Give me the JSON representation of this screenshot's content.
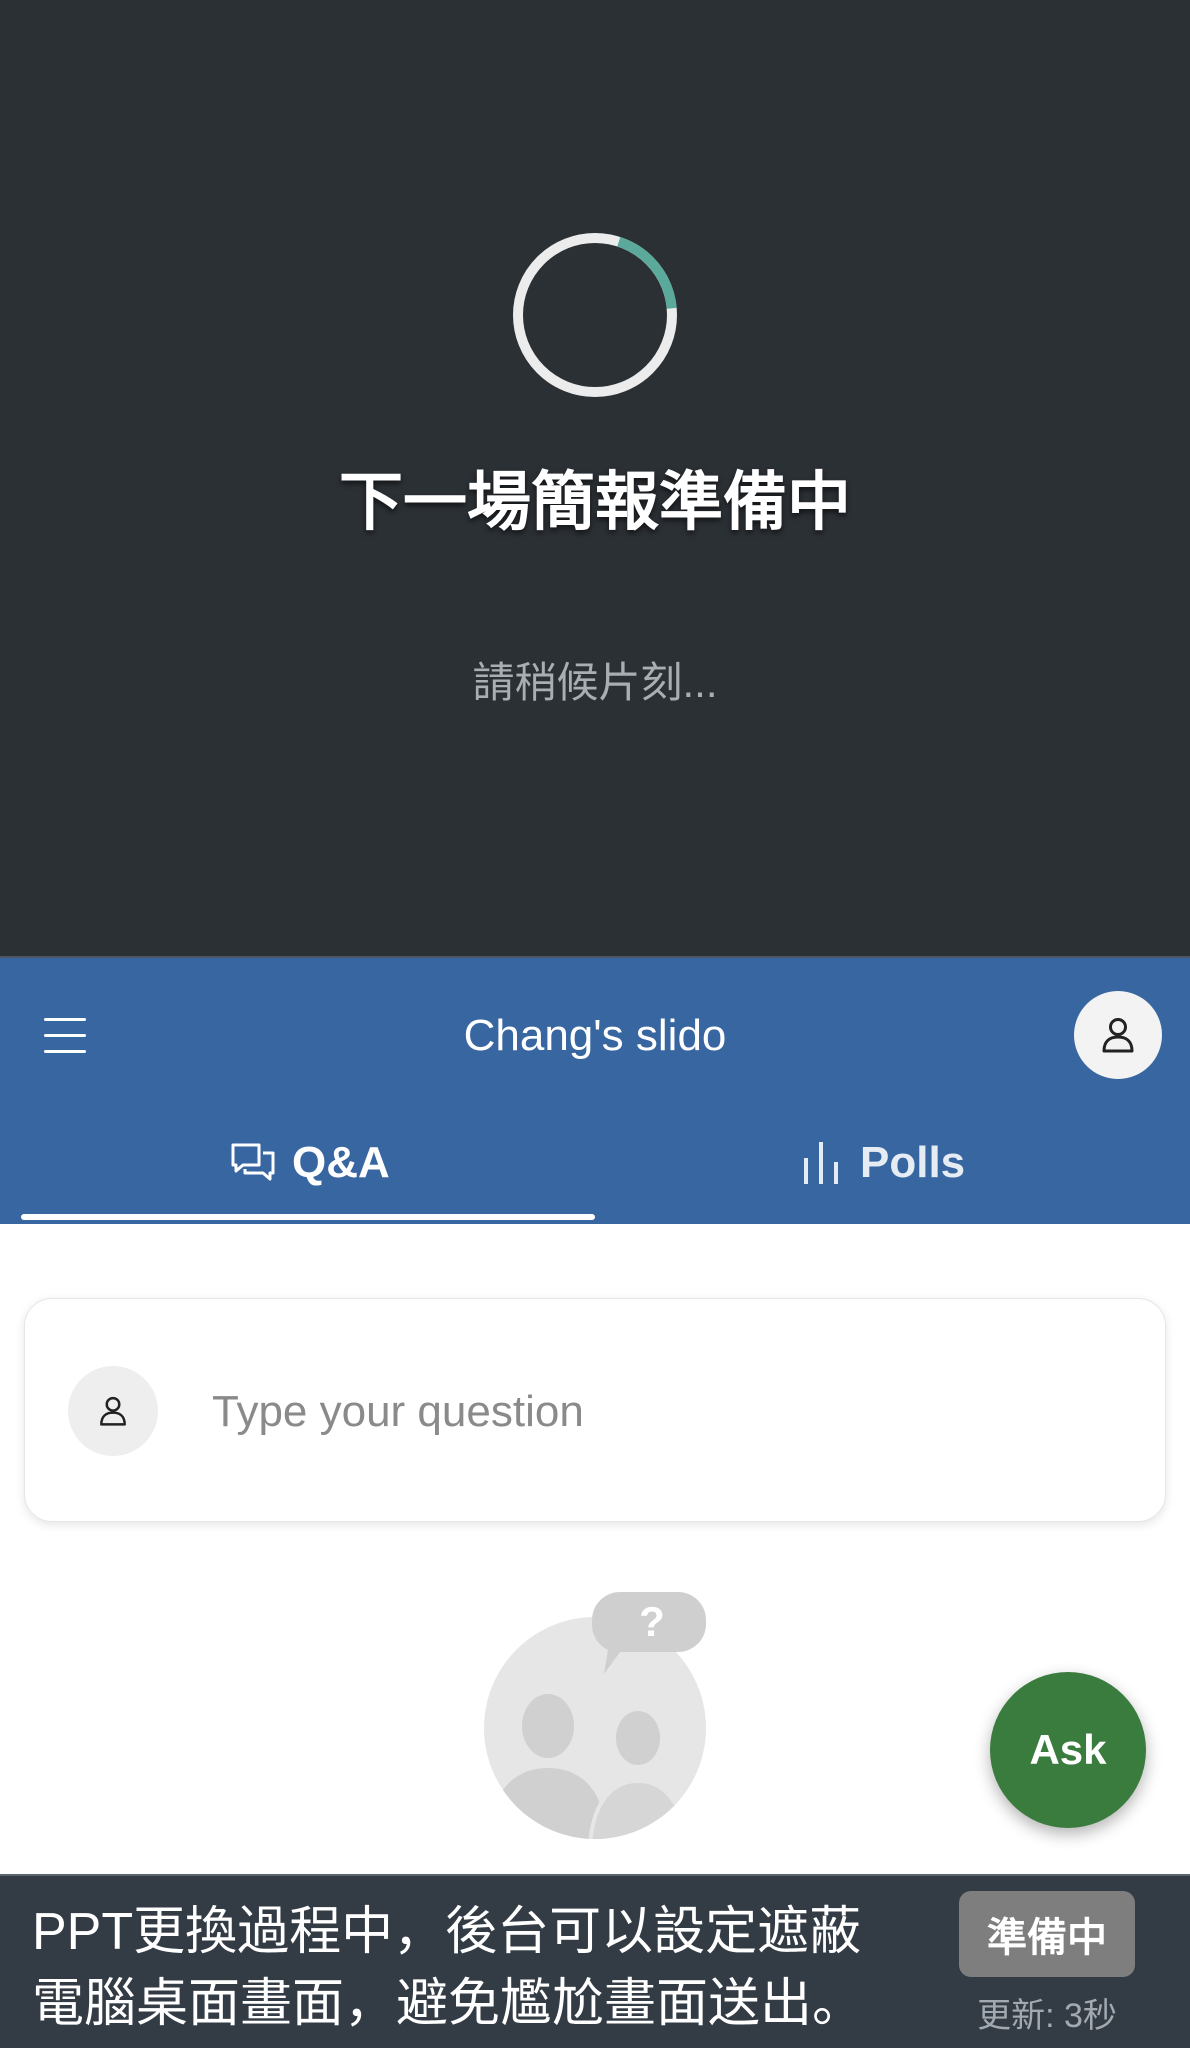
{
  "colors": {
    "top_background": "#2b3035",
    "header_background": "#3866a1",
    "spinner_accent": "#5aa99a",
    "spinner_track": "#ececec",
    "ask_button": "#3a7c3d",
    "bottom_bar": "#333b44",
    "status_badge": "#7e7e7e"
  },
  "loading": {
    "title": "下一場簡報準備中",
    "subtitle": "請稍候片刻..."
  },
  "header": {
    "menu_icon": "hamburger-menu-icon",
    "title": "Chang's slido",
    "avatar_icon": "user-icon"
  },
  "tabs": [
    {
      "label": "Q&A",
      "icon": "chat-bubbles-icon",
      "active": true
    },
    {
      "label": "Polls",
      "icon": "bar-chart-icon",
      "active": false
    }
  ],
  "question_box": {
    "avatar_icon": "user-icon",
    "placeholder": "Type your question"
  },
  "empty_state": {
    "icon": "people-question-icon"
  },
  "ask_button": {
    "label": "Ask"
  },
  "notice_bar": {
    "text": "PPT更換過程中，後台可以設定遮蔽\n電腦桌面畫面，避免尷尬畫面送出。",
    "status": "準備中",
    "updated": "更新: 3秒"
  }
}
